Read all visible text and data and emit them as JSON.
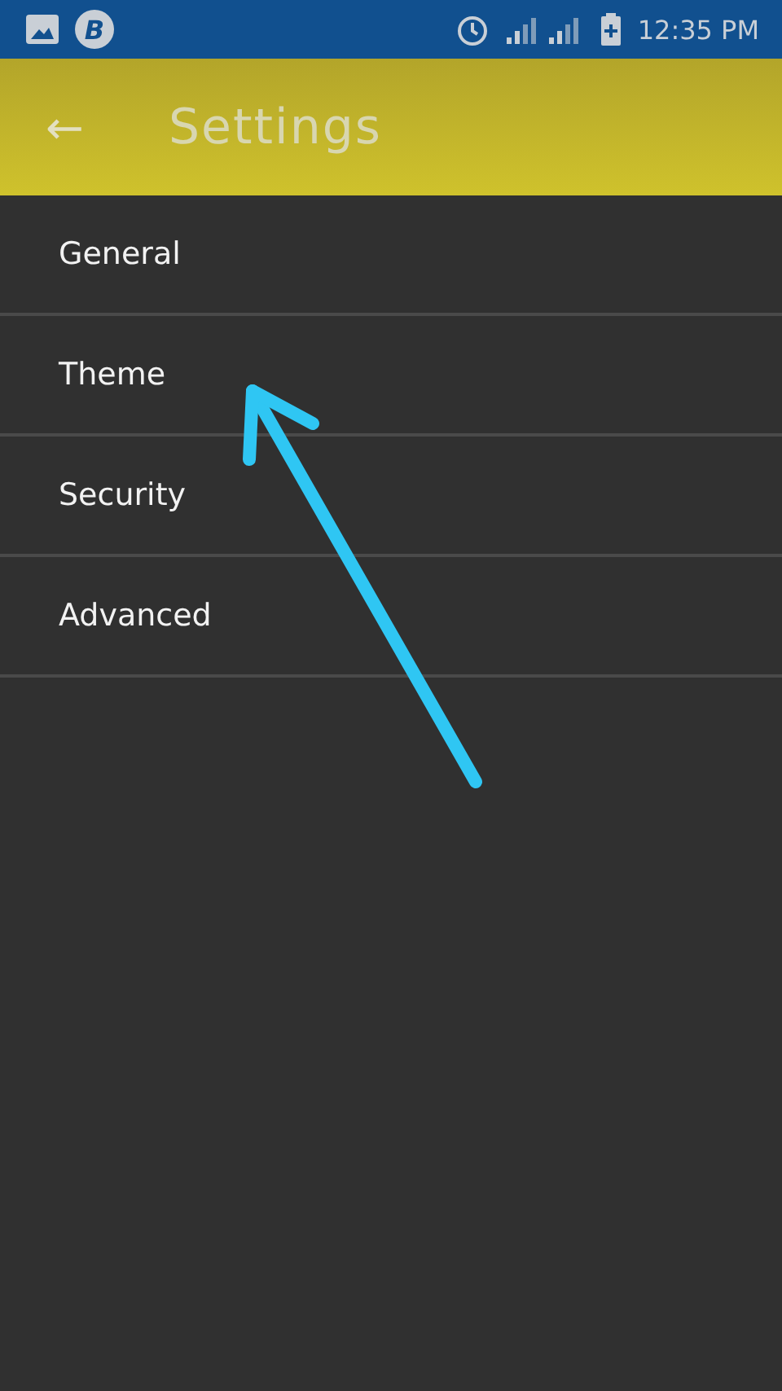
{
  "status_bar": {
    "badge_letter": "B",
    "time": "12:35 PM"
  },
  "app_bar": {
    "back_glyph": "←",
    "title": "Settings"
  },
  "menu": [
    {
      "label": "General"
    },
    {
      "label": "Theme"
    },
    {
      "label": "Security"
    },
    {
      "label": "Advanced"
    }
  ],
  "annotation": {
    "kind": "arrow"
  }
}
